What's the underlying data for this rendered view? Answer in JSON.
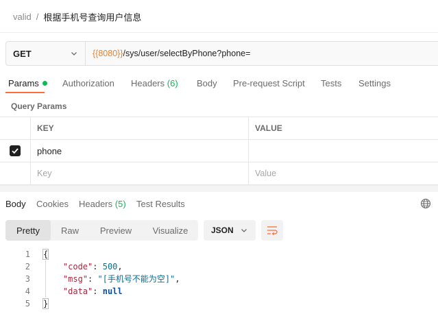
{
  "breadcrumb": {
    "parent": "valid",
    "separator": "/",
    "current": "根据手机号查询用户信息"
  },
  "request": {
    "method": "GET",
    "url_variable": "{{8080}}",
    "url_path": "/sys/user/selectByPhone?phone="
  },
  "request_tabs": [
    {
      "label": "Params",
      "active": true,
      "indicator": "green-dot"
    },
    {
      "label": "Authorization"
    },
    {
      "label": "Headers",
      "count": "(6)"
    },
    {
      "label": "Body"
    },
    {
      "label": "Pre-request Script"
    },
    {
      "label": "Tests"
    },
    {
      "label": "Settings"
    }
  ],
  "query_params": {
    "title": "Query Params",
    "columns": {
      "key": "KEY",
      "value": "VALUE"
    },
    "rows": [
      {
        "checked": true,
        "key": "phone",
        "value": ""
      }
    ],
    "placeholder": {
      "key": "Key",
      "value": "Value"
    }
  },
  "response_tabs": [
    {
      "label": "Body",
      "active": true
    },
    {
      "label": "Cookies"
    },
    {
      "label": "Headers",
      "count": "(5)"
    },
    {
      "label": "Test Results"
    }
  ],
  "viewer": {
    "modes": [
      "Pretty",
      "Raw",
      "Preview",
      "Visualize"
    ],
    "active_mode": "Pretty",
    "format": "JSON"
  },
  "response_body": {
    "line_numbers": [
      "1",
      "2",
      "3",
      "4",
      "5"
    ],
    "open_brace": "{",
    "close_brace": "}",
    "code_key": "\"code\"",
    "code_value": "500",
    "msg_key": "\"msg\"",
    "msg_value": "\"[手机号不能为空]\"",
    "data_key": "\"data\"",
    "data_value": "null"
  },
  "colors": {
    "accent": "#ff6c37",
    "green": "#0cbb52",
    "url_variable": "#e8812c"
  },
  "icons": {
    "method_dropdown": "chevron-down-icon",
    "globe": "globe-icon",
    "wrap": "wrap-lines-icon",
    "checkbox": "checkmark-icon"
  }
}
